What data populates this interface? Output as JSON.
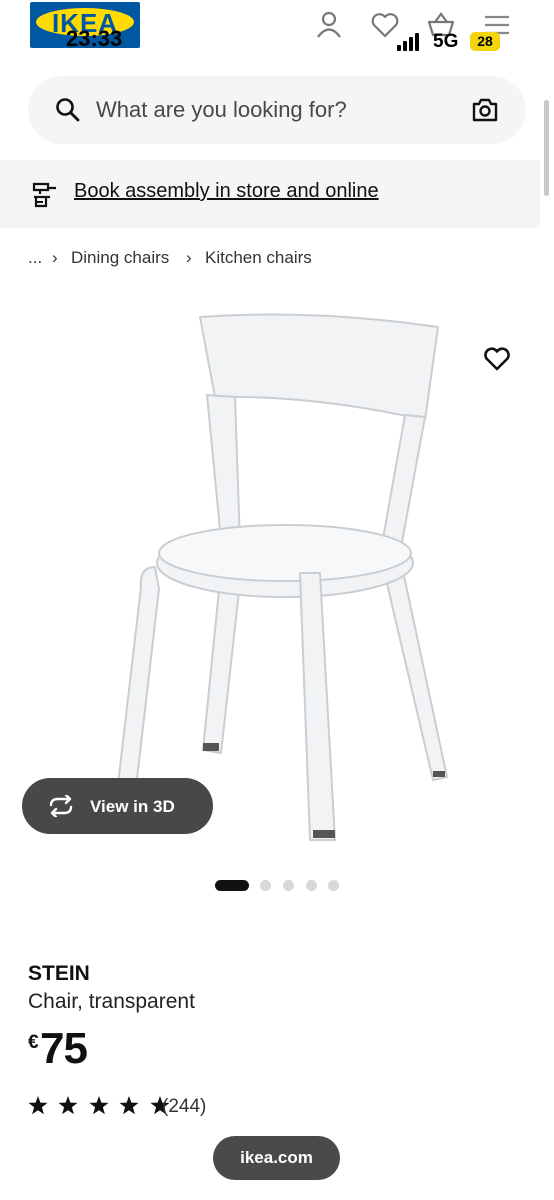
{
  "status_bar": {
    "time": "23:33",
    "network": "5G",
    "battery": "28"
  },
  "header": {
    "logo_text": "IKEA",
    "icons": [
      "user-icon",
      "heart-icon",
      "basket-icon",
      "menu-icon"
    ]
  },
  "search": {
    "placeholder": "What are you looking for?",
    "icons": [
      "search-icon",
      "camera-icon"
    ]
  },
  "banner": {
    "text": "Book assembly in store and online",
    "icon": "assembly-tool-icon"
  },
  "breadcrumb": {
    "items": [
      "...",
      "Dining chairs",
      "Kitchen chairs"
    ]
  },
  "gallery": {
    "view_3d_label": "View in 3D",
    "slide_count": 5,
    "active_slide": 1
  },
  "product": {
    "name": "STEIN",
    "description": "Chair, transparent",
    "currency": "€",
    "price": "75",
    "rating": 5,
    "review_count": "(244)"
  },
  "browser": {
    "url": "ikea.com"
  },
  "colors": {
    "ikea_blue": "#0058a3",
    "ikea_yellow": "#ffdb00",
    "battery": "#f2d50f",
    "pill": "#484848"
  }
}
